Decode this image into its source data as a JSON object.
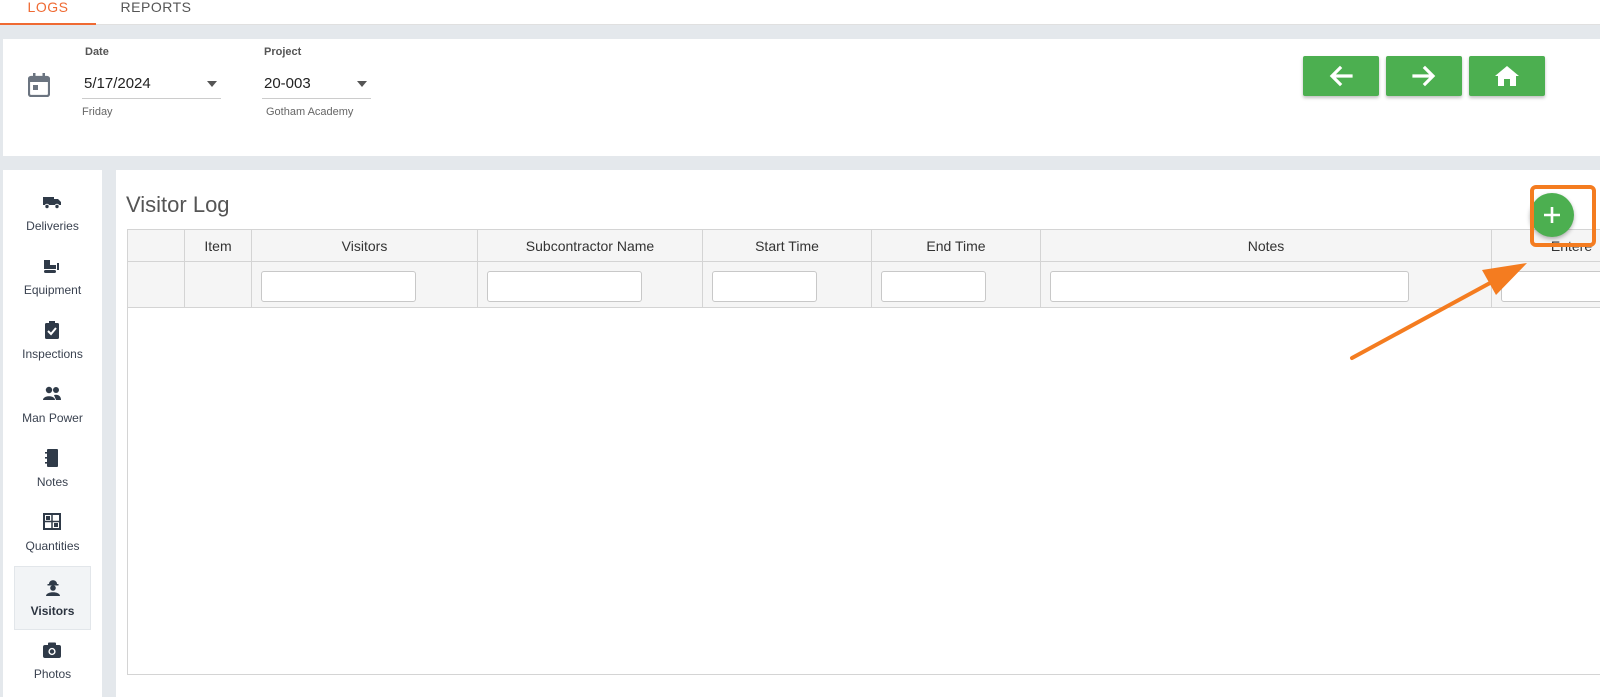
{
  "tabs": [
    {
      "label": "LOGS",
      "active": true
    },
    {
      "label": "REPORTS",
      "active": false
    }
  ],
  "header": {
    "date_label": "Date",
    "date_value": "5/17/2024",
    "date_helper": "Friday",
    "project_label": "Project",
    "project_value": "20-003",
    "project_helper": "Gotham Academy"
  },
  "nav_buttons": [
    "arrow-left-icon",
    "arrow-right-icon",
    "home-icon"
  ],
  "sidebar": {
    "items": [
      {
        "label": "Deliveries",
        "icon": "truck-icon"
      },
      {
        "label": "Equipment",
        "icon": "bulldozer-icon"
      },
      {
        "label": "Inspections",
        "icon": "clipboard-check-icon"
      },
      {
        "label": "Man Power",
        "icon": "people-icon"
      },
      {
        "label": "Notes",
        "icon": "notebook-icon"
      },
      {
        "label": "Quantities",
        "icon": "calculator-icon"
      },
      {
        "label": "Visitors",
        "icon": "worker-icon",
        "active": true
      },
      {
        "label": "Photos",
        "icon": "camera-icon"
      }
    ]
  },
  "main": {
    "title": "Visitor Log",
    "columns": [
      "",
      "Item",
      "Visitors",
      "Subcontractor Name",
      "Start Time",
      "End Time",
      "Notes",
      "Entere"
    ]
  },
  "colors": {
    "accent_orange": "#ef6a33",
    "button_green": "#4caf50",
    "annotation_orange": "#f47c20"
  }
}
